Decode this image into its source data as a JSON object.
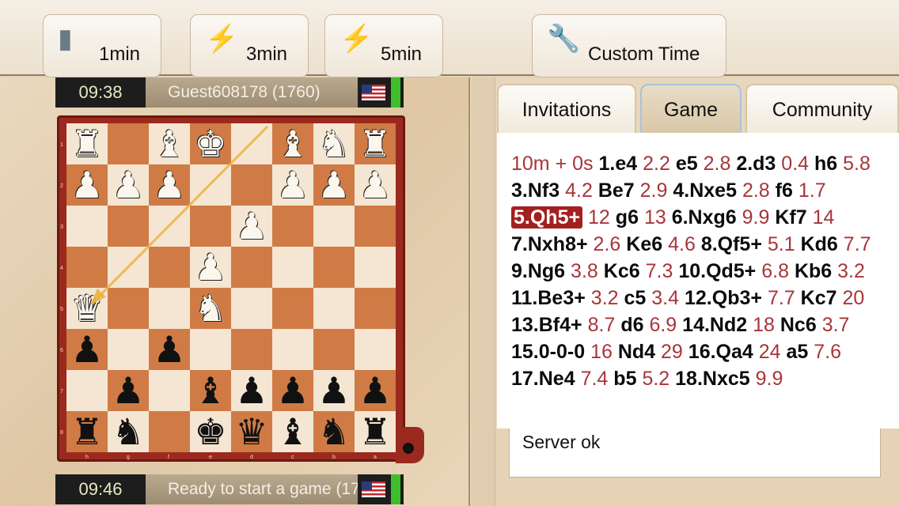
{
  "toolbar": {
    "buttons": [
      {
        "label": "1min",
        "icon": "bullet-icon"
      },
      {
        "label": "3min",
        "icon": "lightning-icon"
      },
      {
        "label": "5min",
        "icon": "lightning-icon"
      },
      {
        "label": "Custom Time",
        "icon": "wrench-icon"
      }
    ]
  },
  "top_player": {
    "time": "09:38",
    "name": "Guest608178 (1760)",
    "flag": "us-flag-icon"
  },
  "bottom_player": {
    "time": "09:46",
    "status": "Ready to start a game (17",
    "flag": "us-flag-icon"
  },
  "tabs": [
    {
      "label": "Invitations",
      "active": false
    },
    {
      "label": "Game",
      "active": true
    },
    {
      "label": "Community",
      "active": false
    }
  ],
  "board": {
    "ranks": [
      "1",
      "2",
      "3",
      "4",
      "5",
      "6",
      "7",
      "8"
    ],
    "files": [
      "h",
      "g",
      "f",
      "e",
      "d",
      "c",
      "b",
      "a"
    ],
    "rows": [
      [
        "wR",
        "",
        "wB",
        "wK",
        "",
        "wB",
        "wN",
        "wR"
      ],
      [
        "wP",
        "wP",
        "wP",
        "",
        "",
        "wP",
        "wP",
        "wP"
      ],
      [
        "",
        "",
        "",
        "",
        "wP",
        "",
        "",
        ""
      ],
      [
        "",
        "",
        "",
        "wP",
        "",
        "",
        "",
        ""
      ],
      [
        "wQ",
        "",
        "",
        "wN",
        "",
        "",
        "",
        ""
      ],
      [
        "bP",
        "",
        "bP",
        "",
        "",
        "",
        "",
        ""
      ],
      [
        "",
        "bP",
        "",
        "bB",
        "bP",
        "bP",
        "bP",
        "bP"
      ],
      [
        "bR",
        "bN",
        "",
        "bK",
        "bQ",
        "bB",
        "bN",
        "bR"
      ]
    ],
    "last_move_arrow": {
      "from": "d1",
      "to": "h5",
      "color": "#f0b040"
    }
  },
  "moves": {
    "time_control": "10m + 0s",
    "entries": [
      {
        "m": "1.e4",
        "t": "2.2"
      },
      {
        "m": "e5",
        "t": "2.8"
      },
      {
        "m": "2.d3",
        "t": "0.4"
      },
      {
        "m": "h6",
        "t": "5.8"
      },
      {
        "m": "3.Nf3",
        "t": "4.2"
      },
      {
        "m": "Be7",
        "t": "2.9"
      },
      {
        "m": "4.Nxe5",
        "t": "2.8"
      },
      {
        "m": "f6",
        "t": "1.7"
      },
      {
        "m": "5.Qh5+",
        "t": "12",
        "current": true
      },
      {
        "m": "g6",
        "t": "13"
      },
      {
        "m": "6.Nxg6",
        "t": "9.9"
      },
      {
        "m": "Kf7",
        "t": "14"
      },
      {
        "m": "7.Nxh8+",
        "t": "2.6"
      },
      {
        "m": "Ke6",
        "t": "4.6"
      },
      {
        "m": "8.Qf5+",
        "t": "5.1"
      },
      {
        "m": "Kd6",
        "t": "7.7"
      },
      {
        "m": "9.Ng6",
        "t": "3.8"
      },
      {
        "m": "Kc6",
        "t": "7.3"
      },
      {
        "m": "10.Qd5+",
        "t": "6.8"
      },
      {
        "m": "Kb6",
        "t": "3.2"
      },
      {
        "m": "11.Be3+",
        "t": "3.2"
      },
      {
        "m": "c5",
        "t": "3.4"
      },
      {
        "m": "12.Qb3+",
        "t": "7.7"
      },
      {
        "m": "Kc7",
        "t": "20"
      },
      {
        "m": "13.Bf4+",
        "t": "8.7"
      },
      {
        "m": "d6",
        "t": "6.9"
      },
      {
        "m": "14.Nd2",
        "t": "18"
      },
      {
        "m": "Nc6",
        "t": "3.7"
      },
      {
        "m": "15.0-0-0",
        "t": "16"
      },
      {
        "m": "Nd4",
        "t": "29"
      },
      {
        "m": "16.Qa4",
        "t": "24"
      },
      {
        "m": "a5",
        "t": "7.6"
      },
      {
        "m": "17.Ne4",
        "t": "7.4"
      },
      {
        "m": "b5",
        "t": "5.2"
      },
      {
        "m": "18.Nxc5",
        "t": "9.9"
      }
    ]
  },
  "message": "Server ok",
  "colors": {
    "accent": "#a3201f",
    "clock_indicator": "#3cbf2a",
    "board_light": "#f4e6d2",
    "board_dark": "#d07b45"
  }
}
